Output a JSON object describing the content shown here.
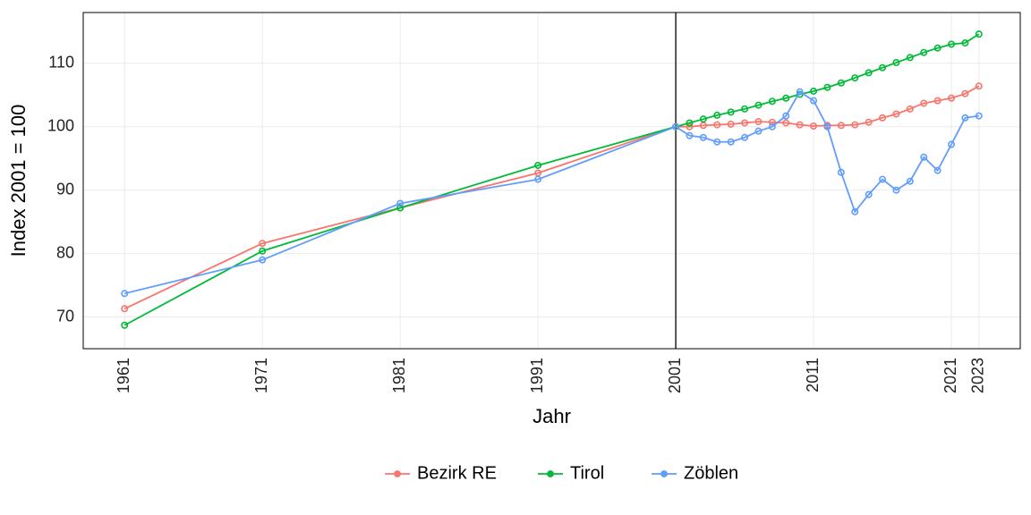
{
  "chart_data": {
    "type": "line",
    "xlabel": "Jahr",
    "ylabel": "Index 2001 = 100",
    "xlim": [
      1958,
      2026
    ],
    "ylim": [
      65,
      118
    ],
    "x_ticks": [
      1961,
      1971,
      1981,
      1991,
      2001,
      2011,
      2021,
      2023
    ],
    "y_ticks": [
      70,
      80,
      90,
      100,
      110
    ],
    "vline_x": 2001,
    "series": [
      {
        "name": "Bezirk RE",
        "color": "#F8766D",
        "x": [
          1961,
          1971,
          1981,
          1991,
          2001,
          2002,
          2003,
          2004,
          2005,
          2006,
          2007,
          2008,
          2009,
          2010,
          2011,
          2012,
          2013,
          2014,
          2015,
          2016,
          2017,
          2018,
          2019,
          2020,
          2021,
          2022,
          2023
        ],
        "y": [
          71.3,
          81.6,
          87.2,
          92.7,
          100.0,
          100.0,
          100.2,
          100.3,
          100.4,
          100.6,
          100.8,
          100.7,
          100.6,
          100.3,
          100.1,
          100.2,
          100.2,
          100.3,
          100.7,
          101.4,
          102.0,
          102.8,
          103.7,
          104.1,
          104.5,
          105.2,
          106.4
        ]
      },
      {
        "name": "Tirol",
        "color": "#00BA38",
        "x": [
          1961,
          1971,
          1981,
          1991,
          2001,
          2002,
          2003,
          2004,
          2005,
          2006,
          2007,
          2008,
          2009,
          2010,
          2011,
          2012,
          2013,
          2014,
          2015,
          2016,
          2017,
          2018,
          2019,
          2020,
          2021,
          2022,
          2023
        ],
        "y": [
          68.7,
          80.4,
          87.2,
          93.9,
          100.0,
          100.6,
          101.2,
          101.8,
          102.3,
          102.8,
          103.4,
          104.0,
          104.5,
          105.1,
          105.6,
          106.2,
          106.9,
          107.7,
          108.5,
          109.3,
          110.1,
          110.9,
          111.7,
          112.4,
          113.0,
          113.2,
          114.6
        ]
      },
      {
        "name": "Zöblen",
        "color": "#619CFF",
        "x": [
          1961,
          1971,
          1981,
          1991,
          2001,
          2002,
          2003,
          2004,
          2005,
          2006,
          2007,
          2008,
          2009,
          2010,
          2011,
          2012,
          2013,
          2014,
          2015,
          2016,
          2017,
          2018,
          2019,
          2020,
          2021,
          2022,
          2023
        ],
        "y": [
          73.7,
          79.0,
          87.9,
          91.7,
          100.0,
          98.6,
          98.3,
          97.6,
          97.6,
          98.3,
          99.3,
          100.0,
          101.7,
          105.5,
          104.1,
          100.0,
          92.8,
          86.6,
          89.3,
          91.7,
          90.0,
          91.4,
          95.2,
          93.1,
          97.2,
          101.4,
          101.7
        ]
      }
    ],
    "legend": {
      "items": [
        "Bezirk RE",
        "Tirol",
        "Zöblen"
      ]
    }
  }
}
